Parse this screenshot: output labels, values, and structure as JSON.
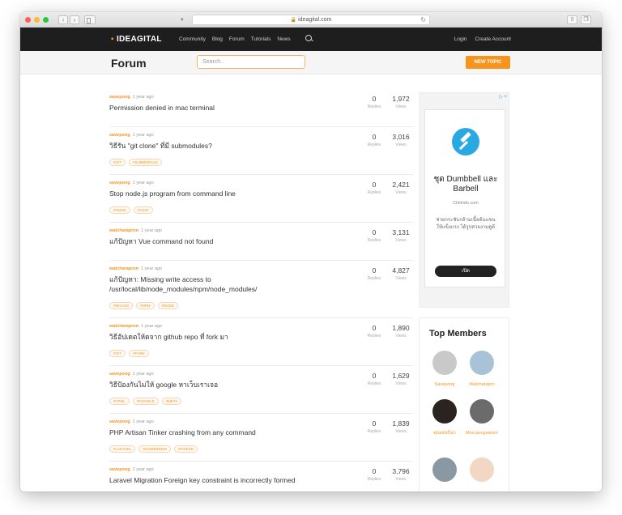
{
  "browser": {
    "url": "ideagital.com",
    "nav_back": "‹",
    "nav_fwd": "›"
  },
  "site": {
    "logo_text": "IDEAGITAL",
    "nav": [
      "Community",
      "Blog",
      "Forum",
      "Tutorials",
      "News"
    ],
    "auth": [
      "Login",
      "Create Account"
    ]
  },
  "page": {
    "title": "Forum",
    "search_placeholder": "Search..",
    "new_topic_label": "NEW TOPIC"
  },
  "topics": [
    {
      "author": "savepong",
      "time": "1 year ago",
      "title": "Permission denied in mac terminal",
      "tags": [],
      "replies": "0",
      "views": "1,972"
    },
    {
      "author": "savepong",
      "time": "1 year ago",
      "title": "วิธีรัน \"git clone\" ที่มี submodules?",
      "tags": [
        "#GIT",
        "#SUBMODULE"
      ],
      "replies": "0",
      "views": "3,016"
    },
    {
      "author": "savepong",
      "time": "1 year ago",
      "title": "Stop node.js program from command line",
      "tags": [
        "#NODE",
        "#YUST"
      ],
      "replies": "0",
      "views": "2,421"
    },
    {
      "author": "watcharapron",
      "time": "1 year ago",
      "title": "แก้ปัญหา Vue command not found",
      "tags": [],
      "replies": "0",
      "views": "3,131"
    },
    {
      "author": "watcharapron",
      "time": "1 year ago",
      "title": "แก้ปัญหา: Missing write access to /usr/local/lib/node_modules/npm/node_modules/",
      "tags": [
        "#MACOS",
        "#NPM",
        "#NODE"
      ],
      "replies": "0",
      "views": "4,827"
    },
    {
      "author": "watcharapron",
      "time": "1 year ago",
      "title": "วิธีอัปเดตให้ดจาก github repo ที่ fork มา",
      "tags": [
        "#GIT",
        "#FORK"
      ],
      "replies": "0",
      "views": "1,890"
    },
    {
      "author": "savepong",
      "time": "1 year ago",
      "title": "วิธีป้องกันไม่ให้ google หาเว็บเราเจอ",
      "tags": [
        "#HTML",
        "#GOOGLE",
        "#META"
      ],
      "replies": "0",
      "views": "1,629"
    },
    {
      "author": "savepong",
      "time": "1 year ago",
      "title": "PHP Artisan Tinker crashing from any command",
      "tags": [
        "#LARAVEL",
        "#HOMEBREW",
        "#TINKER"
      ],
      "replies": "0",
      "views": "1,839"
    },
    {
      "author": "savepong",
      "time": "1 year ago",
      "title": "Laravel Migration Foreign key constraint is incorrectly formed",
      "tags": [],
      "replies": "0",
      "views": "3,796"
    }
  ],
  "labels": {
    "replies": "Replies",
    "views": "Views"
  },
  "ad": {
    "close": "▷ ×",
    "headline": "ชุด Dumbbell และ Barbell",
    "domain": "Chilindo.com",
    "body": "ช่วยกระชับกล้ามเนื้อต้นแขนให้แข็งแรง ได้รูปสวยงามดูดี",
    "cta": "เปิด",
    "logo_color": "#29a9e1"
  },
  "members": {
    "heading": "Top Members",
    "list": [
      {
        "name": "Savepong",
        "color": "#c9c9c9"
      },
      {
        "name": "Watcharapro",
        "color": "#a9c3d6"
      },
      {
        "name": "คุณเตยก็อก",
        "color": "#2a2320"
      },
      {
        "name": "Mos-pongsatorn",
        "color": "#6b6b6b"
      },
      {
        "name": "",
        "color": "#8a98a4"
      },
      {
        "name": "",
        "color": "#f2d7c4"
      }
    ]
  },
  "colors": {
    "accent": "#f7941d",
    "nav_bg": "#1e1e1e"
  }
}
